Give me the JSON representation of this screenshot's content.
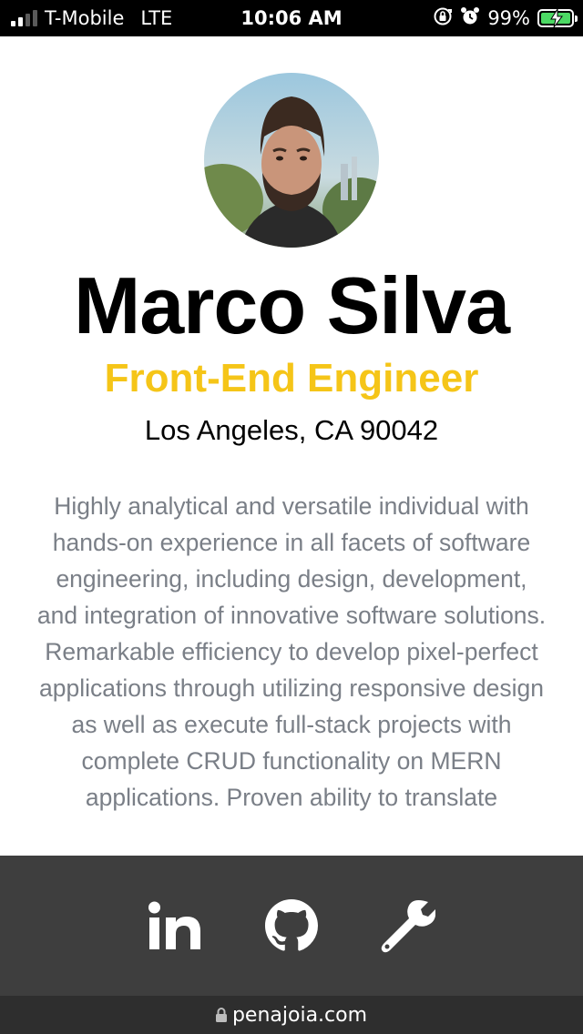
{
  "status_bar": {
    "carrier": "T-Mobile",
    "network": "LTE",
    "time": "10:06 AM",
    "battery_percent": "99%",
    "signal_bars": 2,
    "icons": [
      "orientation-lock-icon",
      "alarm-icon",
      "battery-charging-icon"
    ]
  },
  "profile": {
    "name": "Marco Silva",
    "title": "Front-End Engineer",
    "location": "Los Angeles, CA 90042",
    "bio": "Highly analytical and versatile individual with hands-on experience in all facets of software engineering, including design, development, and integration of innovative software solutions. Remarkable efficiency to develop pixel-perfect applications through utilizing responsive design as well as execute full-stack projects with complete CRUD functionality on MERN applications. Proven ability to translate"
  },
  "footer": {
    "links": [
      {
        "icon": "linkedin-icon"
      },
      {
        "icon": "github-icon"
      },
      {
        "icon": "wrench-icon"
      }
    ]
  },
  "browser": {
    "url": "penajoia.com",
    "lock_icon": "lock-icon"
  },
  "colors": {
    "title_accent": "#f5c518",
    "bio_text": "#7a7f87",
    "footer_bg": "#3e3e3e",
    "battery_green": "#4cd964"
  }
}
